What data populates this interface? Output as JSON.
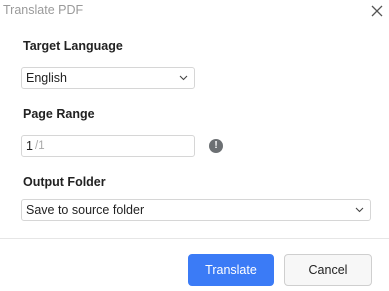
{
  "dialog": {
    "title": "Translate PDF"
  },
  "target_language": {
    "label": "Target Language",
    "value": "English"
  },
  "page_range": {
    "label": "Page Range",
    "current": "1",
    "total": "/1"
  },
  "output_folder": {
    "label": "Output Folder",
    "value": "Save to source folder"
  },
  "buttons": {
    "translate": "Translate",
    "cancel": "Cancel"
  },
  "colors": {
    "primary": "#3b7bf6",
    "info_icon": "#6c7073"
  },
  "icons": {
    "close": "close-icon",
    "dropdown": "chevron-down-icon",
    "info": "info-icon"
  }
}
